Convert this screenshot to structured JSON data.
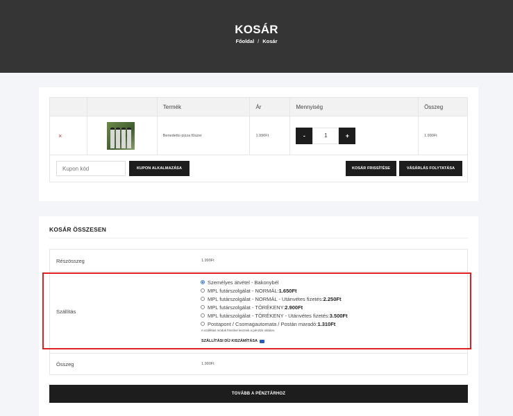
{
  "hero": {
    "title": "KOSÁR",
    "breadcrumbs": [
      "Főoldal",
      "Kosár"
    ],
    "separator": "/"
  },
  "cart": {
    "headers": [
      "",
      "",
      "Termék",
      "Ár",
      "Mennyiség",
      "Összeg"
    ],
    "items": [
      {
        "remove": "×",
        "name": "Benedetto pizza fűszer",
        "price": "1.990Ft",
        "qty": "1",
        "subtotal": "1.990Ft"
      }
    ],
    "qty_minus": "-",
    "qty_plus": "+",
    "coupon_placeholder": "Kupon kód",
    "apply_coupon": "KUPON ALKALMAZÁSA",
    "update_cart": "KOSÁR FRISSÍTÉSE",
    "continue_shopping": "VÁSÁRLÁS FOLYTATÁSA"
  },
  "totals": {
    "heading": "KOSÁR ÖSSZESEN",
    "subtotal_label": "Részösszeg",
    "subtotal_value": "1.990Ft",
    "shipping_label": "Szállítás",
    "shipping_options": [
      {
        "text": "Személyes átvétel - Bakonybél",
        "price": "",
        "selected": true
      },
      {
        "text": "MPL futárszolgálat - NORMÁL: ",
        "price": "1.650Ft",
        "selected": false
      },
      {
        "text": "MPL futárszolgálat - NORMÁL - Utánvétes fizetés: ",
        "price": "2.250Ft",
        "selected": false
      },
      {
        "text": "MPL futárszolgálat - TÖRÉKENY: ",
        "price": "2.900Ft",
        "selected": false
      },
      {
        "text": "MPL futárszolgálat - TÖRÉKENY - Utánvétes fizetés: ",
        "price": "3.500Ft",
        "selected": false
      },
      {
        "text": "Postapont / Csomagautomata / Postán maradó: ",
        "price": "1.310Ft",
        "selected": false
      }
    ],
    "shipping_note": "A szállítási módok frissítve lesznek a pénztár oldalon.",
    "calculate_shipping": "SZÁLLÍTÁSI DÍJ KISZÁMÍTÁSA",
    "total_label": "Összeg",
    "total_value": "1.990Ft",
    "checkout": "TOVÁBB A PÉNZTÁRHOZ"
  },
  "colors": {
    "hero_bg": "#353535",
    "highlight": "#e02020",
    "button": "#1d1d1d"
  }
}
